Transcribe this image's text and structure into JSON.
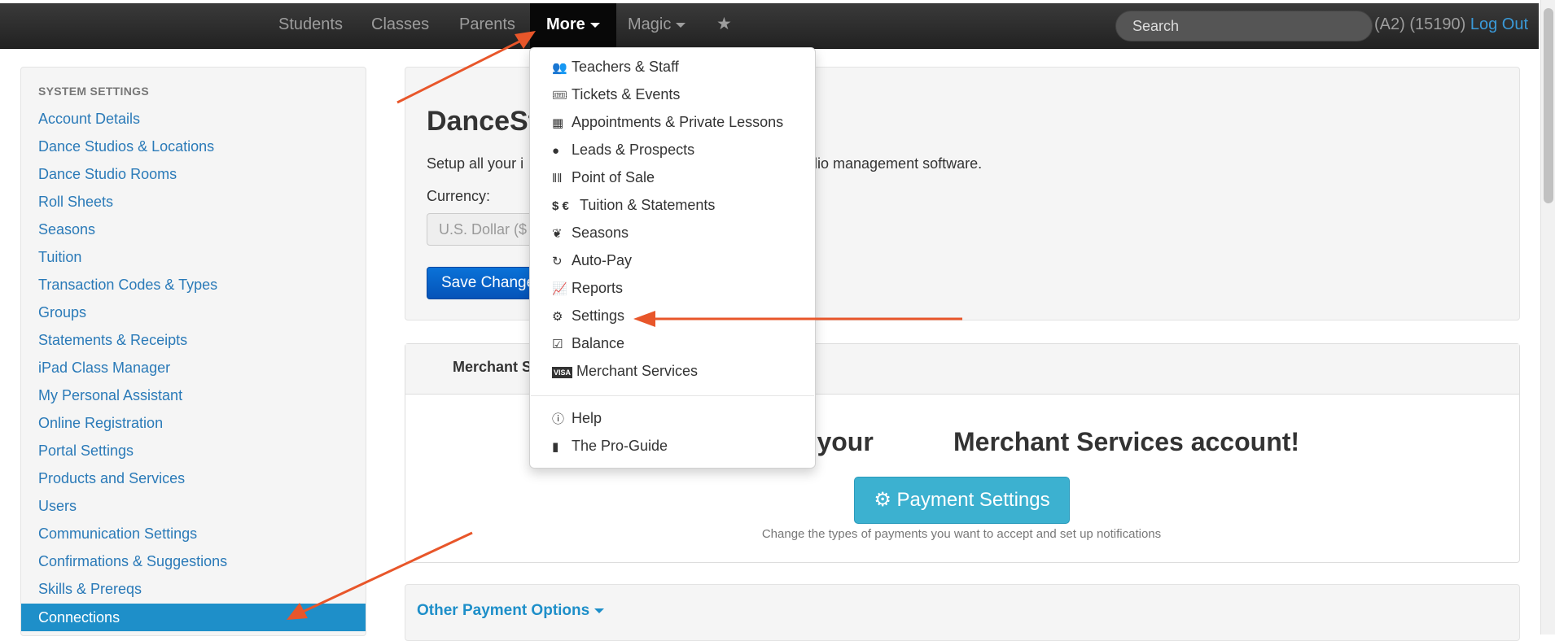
{
  "navbar": {
    "items": [
      {
        "label": "Students"
      },
      {
        "label": "Classes"
      },
      {
        "label": "Parents"
      },
      {
        "label": "More"
      },
      {
        "label": "Magic"
      }
    ],
    "star_icon": "star-icon",
    "search_placeholder": "Search",
    "user_text": "(A2) (15190)",
    "logout_label": "Log Out"
  },
  "sidebar": {
    "header": "SYSTEM SETTINGS",
    "items": [
      {
        "label": "Account Details"
      },
      {
        "label": "Dance Studios & Locations"
      },
      {
        "label": "Dance Studio Rooms"
      },
      {
        "label": "Roll Sheets"
      },
      {
        "label": "Seasons"
      },
      {
        "label": "Tuition"
      },
      {
        "label": "Transaction Codes & Types"
      },
      {
        "label": "Groups"
      },
      {
        "label": "Statements & Receipts"
      },
      {
        "label": "iPad Class Manager"
      },
      {
        "label": "My Personal Assistant"
      },
      {
        "label": "Online Registration"
      },
      {
        "label": "Portal Settings"
      },
      {
        "label": "Products and Services"
      },
      {
        "label": "Users"
      },
      {
        "label": "Communication Settings"
      },
      {
        "label": "Confirmations & Suggestions"
      },
      {
        "label": "Skills & Prereqs"
      },
      {
        "label": "Connections"
      }
    ],
    "active": "Connections"
  },
  "main": {
    "title": "DanceSt",
    "setup_text_left": "Setup all your i",
    "setup_text_right": "lio management software.",
    "currency_label": "Currency:",
    "currency_value": "U.S. Dollar ($",
    "save_label": "Save Changes",
    "merchant_tab": "Merchant S",
    "heading_left": "o your",
    "heading_right": "Merchant Services account!",
    "payment_settings_label": "Payment Settings",
    "payment_caption": "Change the types of payments you want to accept and set up notifications",
    "other_payment_label": "Other Payment Options"
  },
  "dropdown": {
    "items": [
      {
        "label": "Teachers & Staff",
        "icon": "users-icon"
      },
      {
        "label": "Tickets & Events",
        "icon": "ticket-icon"
      },
      {
        "label": "Appointments & Private Lessons",
        "icon": "calendar-icon"
      },
      {
        "label": "Leads & Prospects",
        "icon": "map-marker-icon"
      },
      {
        "label": "Point of Sale",
        "icon": "barcode-icon"
      },
      {
        "label": "Tuition & Statements",
        "icon": "currency-icon"
      },
      {
        "label": "Seasons",
        "icon": "leaf-icon"
      },
      {
        "label": "Auto-Pay",
        "icon": "refresh-icon"
      },
      {
        "label": "Reports",
        "icon": "chart-line-icon"
      },
      {
        "label": "Settings",
        "icon": "gears-icon"
      },
      {
        "label": "Balance",
        "icon": "check-square-icon"
      },
      {
        "label": "Merchant Services",
        "icon": "visa-card-icon"
      }
    ],
    "secondary_items": [
      {
        "label": "Help",
        "icon": "info-circle-icon"
      },
      {
        "label": "The Pro-Guide",
        "icon": "book-icon"
      }
    ]
  },
  "colors": {
    "accent": "#1e8fc9",
    "link": "#2a7ab8",
    "annotation_arrow": "#e8562a",
    "navbar": "#222222"
  }
}
